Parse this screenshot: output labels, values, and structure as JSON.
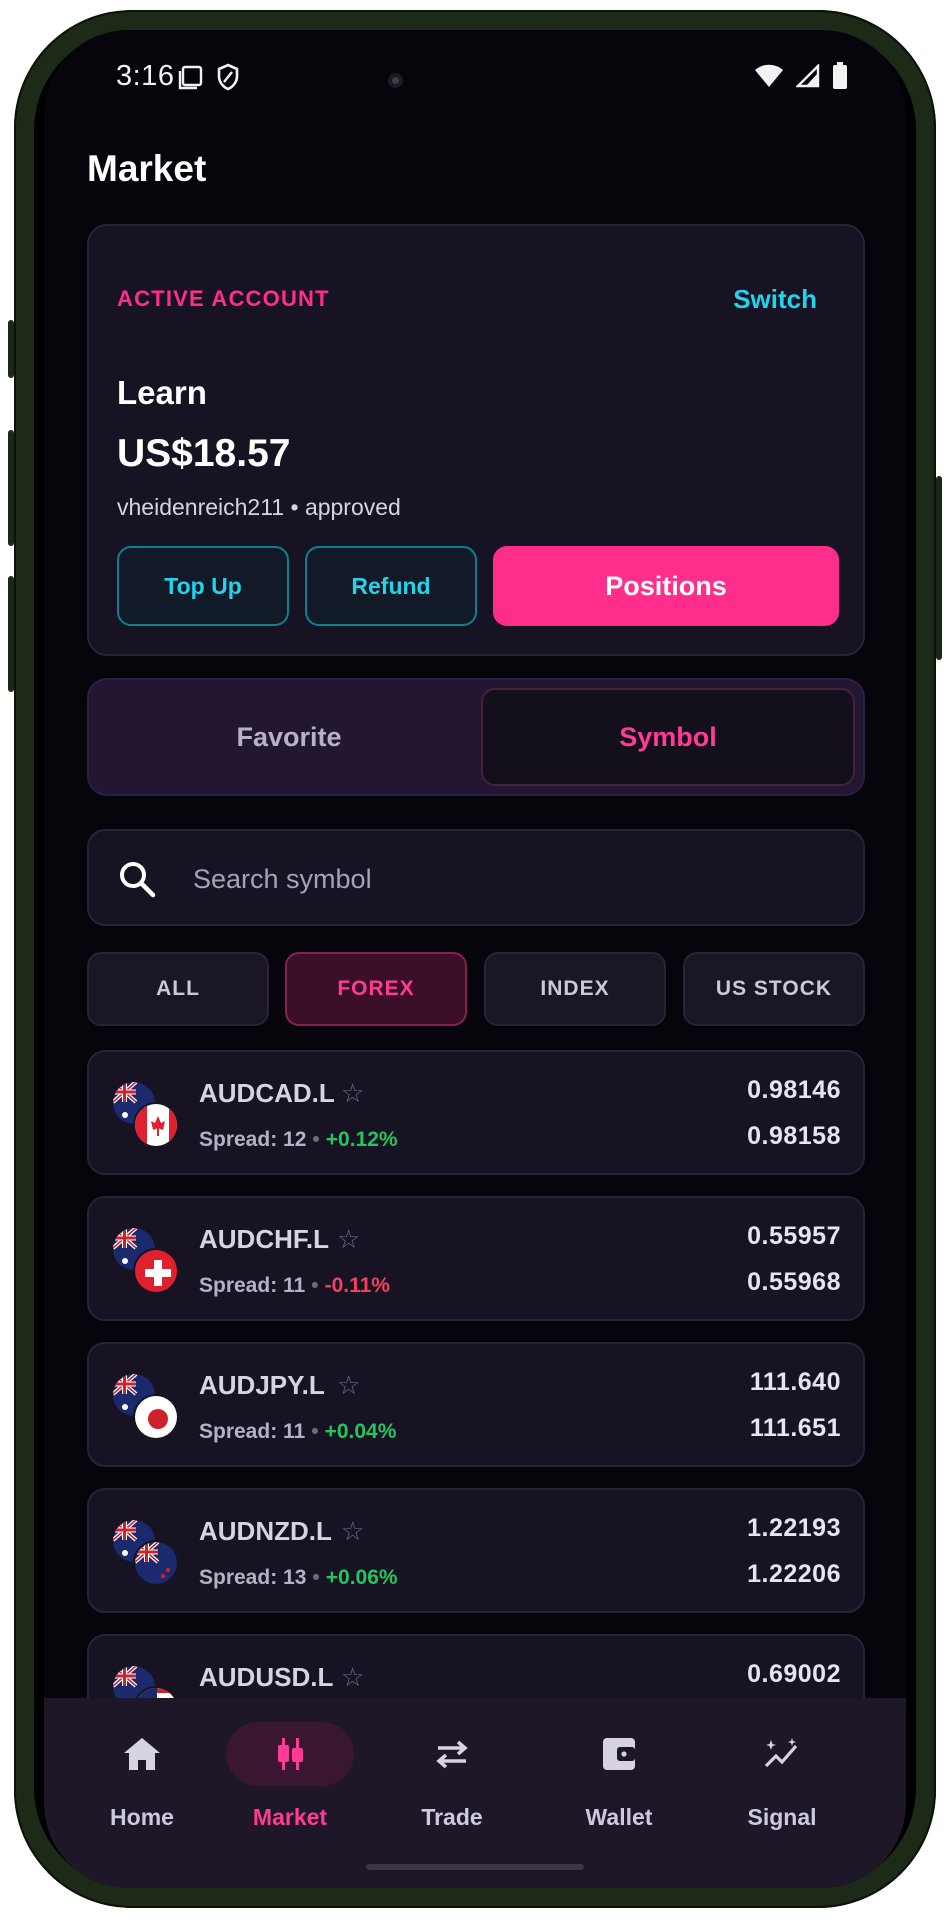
{
  "status_bar": {
    "time": "3:16"
  },
  "page": {
    "title": "Market"
  },
  "account": {
    "label": "ACTIVE ACCOUNT",
    "switch_label": "Switch",
    "name": "Learn",
    "balance": "US$18.57",
    "username": "vheidenreich211",
    "status": "approved",
    "separator": "•",
    "buttons": {
      "top_up": "Top Up",
      "refund": "Refund",
      "positions": "Positions"
    }
  },
  "segments": {
    "favorite": "Favorite",
    "symbol": "Symbol",
    "selected": "Symbol"
  },
  "search": {
    "placeholder": "Search symbol",
    "value": ""
  },
  "filters": {
    "items": [
      "ALL",
      "FOREX",
      "INDEX",
      "US STOCK"
    ],
    "selected": "FOREX"
  },
  "symbols": [
    {
      "name": "AUDCAD.L",
      "spread_label": "Spread: 12",
      "change": "+0.12%",
      "direction": "up",
      "bid": "0.98146",
      "ask": "0.98158",
      "base_flag": "australia-flag-icon",
      "quote_flag": "canada-flag-icon"
    },
    {
      "name": "AUDCHF.L",
      "spread_label": "Spread: 11",
      "change": "-0.11%",
      "direction": "down",
      "bid": "0.55957",
      "ask": "0.55968",
      "base_flag": "australia-flag-icon",
      "quote_flag": "switzerland-flag-icon"
    },
    {
      "name": "AUDJPY.L",
      "spread_label": "Spread: 11",
      "change": "+0.04%",
      "direction": "up",
      "bid": "111.640",
      "ask": "111.651",
      "base_flag": "australia-flag-icon",
      "quote_flag": "japan-flag-icon"
    },
    {
      "name": "AUDNZD.L",
      "spread_label": "Spread: 13",
      "change": "+0.06%",
      "direction": "up",
      "bid": "1.22193",
      "ask": "1.22206",
      "base_flag": "australia-flag-icon",
      "quote_flag": "new-zealand-flag-icon"
    },
    {
      "name": "AUDUSD.L",
      "bid": "0.69002",
      "base_flag": "australia-flag-icon",
      "quote_flag": "usa-flag-icon"
    }
  ],
  "nav": {
    "items": [
      {
        "label": "Home",
        "icon": "home-icon"
      },
      {
        "label": "Market",
        "icon": "candlestick-icon"
      },
      {
        "label": "Trade",
        "icon": "swap-arrows-icon"
      },
      {
        "label": "Wallet",
        "icon": "wallet-icon"
      },
      {
        "label": "Signal",
        "icon": "sparkle-chart-icon"
      }
    ],
    "selected": "Market"
  },
  "colors": {
    "accent": "#ff2d8c",
    "link": "#22d3ee",
    "positive": "#22c55e",
    "negative": "#f43f5e",
    "background": "#07050c",
    "card": "#181322"
  }
}
